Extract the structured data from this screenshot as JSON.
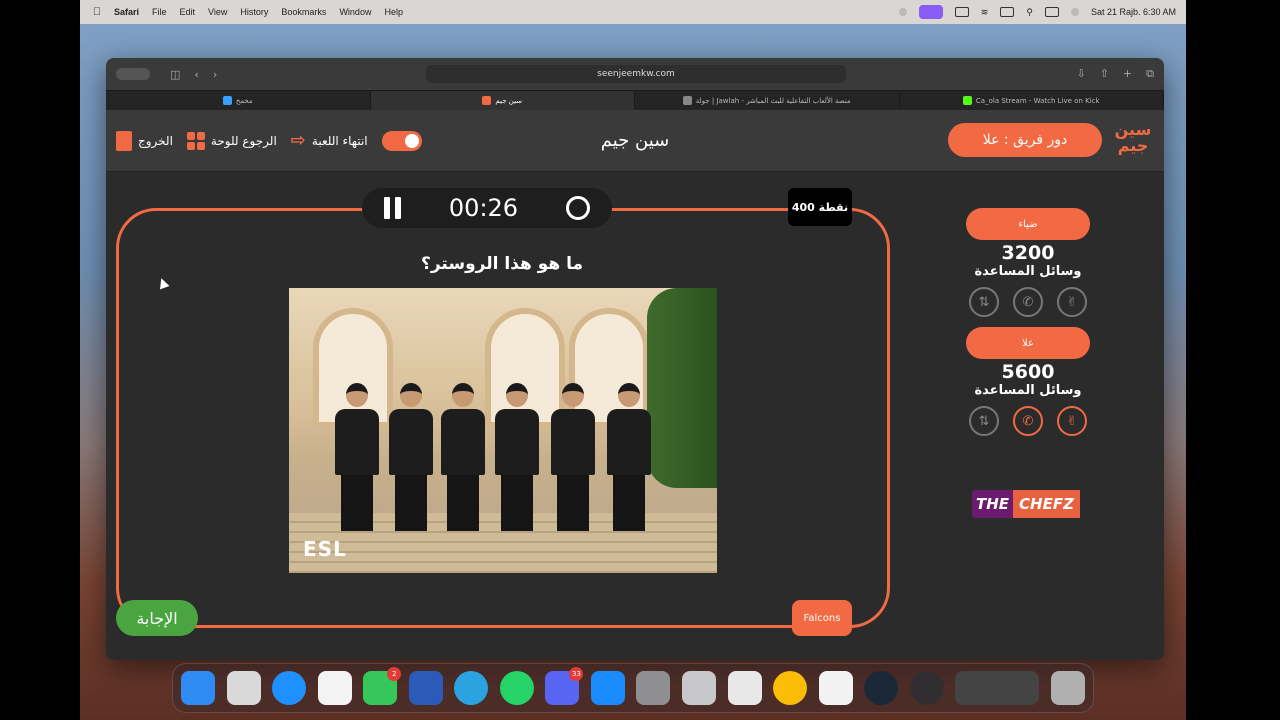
{
  "menubar": {
    "apple_icon": "apple-icon",
    "app_name": "Safari",
    "items": [
      "File",
      "Edit",
      "View",
      "History",
      "Bookmarks",
      "Window",
      "Help"
    ],
    "datetime": "Sat 21 Rajb. 6:30 AM"
  },
  "browser": {
    "url": "seenjeemkw.com",
    "tabs": [
      {
        "title": "مخمخ",
        "active": false,
        "favicon_color": "#3aa0ff"
      },
      {
        "title": "سين جيم",
        "active": true,
        "favicon_color": "#f26a43"
      },
      {
        "title": "جولة | Jawlah - منصة الألعاب التفاعلية للبث المباشر",
        "active": false,
        "favicon_color": "#888888"
      },
      {
        "title": "Ca_ola Stream - Watch Live on Kick",
        "active": false,
        "favicon_color": "#53fc18"
      }
    ]
  },
  "header": {
    "exit_label": "الخروج",
    "back_label": "الرجوع للوحة",
    "end_game_label": "انتهاء اللعبة",
    "title": "سين جيم",
    "turn_label": "دور فريق : علا",
    "logo_text": "سين جيم"
  },
  "game": {
    "timer": "00:26",
    "points_label": "400 نقطة",
    "question": "ما هو هذا الروستر؟",
    "image_watermark": "ESL",
    "answer_button": "الإجابة",
    "team_tag": "Falcons"
  },
  "teams": [
    {
      "name": "ضياء",
      "score": "3200",
      "helpers_label": "وسائل المساعدة",
      "helpers_active": [
        false,
        false,
        false
      ]
    },
    {
      "name": "علا",
      "score": "5600",
      "helpers_label": "وسائل المساعدة",
      "helpers_active": [
        false,
        true,
        true
      ]
    }
  ],
  "sponsor": {
    "part1": "THE",
    "part2": "CHEFZ"
  },
  "dock": {
    "apps": [
      "finder",
      "launchpad",
      "safari",
      "photos",
      "facetime",
      "word",
      "telegram",
      "whatsapp",
      "discord",
      "app-store",
      "system-settings",
      "iphone-mirroring",
      "network-tool",
      "chrome",
      "capture-tool",
      "steam",
      "obs",
      "window-thumbnail",
      "trash"
    ],
    "badges": {
      "facetime": "2",
      "discord": "33"
    }
  },
  "colors": {
    "accent": "#f26a43",
    "answer_green": "#4aa541",
    "background": "#2b2b2b"
  }
}
